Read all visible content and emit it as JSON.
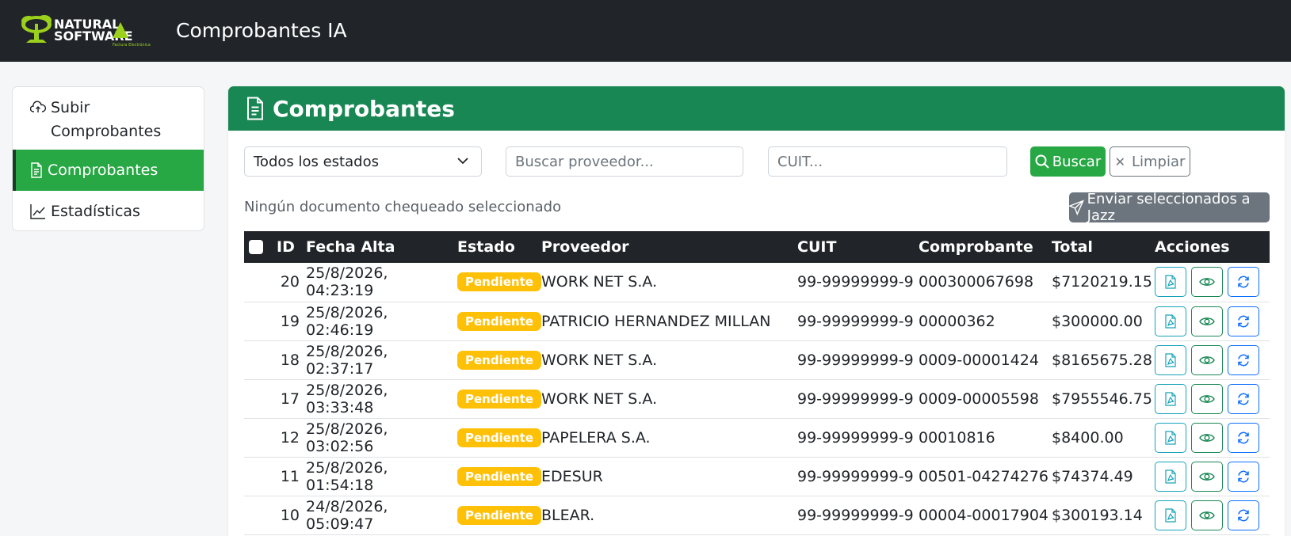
{
  "header": {
    "logo_line1": "NATURAL",
    "logo_line2": "SOFTWARE",
    "logo_sub": "Factura Electrónica",
    "title": "Comprobantes IA"
  },
  "sidebar": {
    "items": [
      {
        "label": "Subir Comprobantes",
        "icon": "cloud-upload-icon"
      },
      {
        "label": "Comprobantes",
        "icon": "file-text-icon",
        "active": true
      },
      {
        "label": "Estadísticas",
        "icon": "line-chart-icon"
      }
    ]
  },
  "card": {
    "title": "Comprobantes"
  },
  "filters": {
    "estado_selected": "Todos los estados",
    "proveedor_placeholder": "Buscar proveedor...",
    "cuit_placeholder": "CUIT...",
    "buscar_label": "Buscar",
    "limpiar_label": "Limpiar"
  },
  "selection": {
    "status_text": "Ningún documento chequeado seleccionado",
    "send_label": "Enviar seleccionados a Jazz"
  },
  "table": {
    "columns": [
      "ID",
      "Fecha Alta",
      "Estado",
      "Proveedor",
      "CUIT",
      "Comprobante",
      "Total",
      "Acciones"
    ],
    "rows": [
      {
        "id": "20",
        "fecha": "25/8/2026, 04:23:19",
        "estado": "Pendiente",
        "proveedor": "WORK NET S.A.",
        "cuit": "99-99999999-9",
        "comprobante": "000300067698",
        "total": "$7120219.15"
      },
      {
        "id": "19",
        "fecha": "25/8/2026, 02:46:19",
        "estado": "Pendiente",
        "proveedor": "PATRICIO HERNANDEZ MILLAN",
        "cuit": "99-99999999-9",
        "comprobante": "00000362",
        "total": "$300000.00"
      },
      {
        "id": "18",
        "fecha": "25/8/2026, 02:37:17",
        "estado": "Pendiente",
        "proveedor": "WORK NET S.A.",
        "cuit": "99-99999999-9",
        "comprobante": "0009-00001424",
        "total": "$8165675.28"
      },
      {
        "id": "17",
        "fecha": "25/8/2026, 03:33:48",
        "estado": "Pendiente",
        "proveedor": "WORK NET S.A.",
        "cuit": "99-99999999-9",
        "comprobante": "0009-00005598",
        "total": "$7955546.75"
      },
      {
        "id": "12",
        "fecha": "25/8/2026, 03:02:56",
        "estado": "Pendiente",
        "proveedor": "PAPELERA S.A.",
        "cuit": "99-99999999-9",
        "comprobante": "00010816",
        "total": "$8400.00"
      },
      {
        "id": "11",
        "fecha": "25/8/2026, 01:54:18",
        "estado": "Pendiente",
        "proveedor": "EDESUR",
        "cuit": "99-99999999-9",
        "comprobante": "00501-04274276",
        "total": "$74374.49"
      },
      {
        "id": "10",
        "fecha": "24/8/2026, 05:09:47",
        "estado": "Pendiente",
        "proveedor": "BLEAR.",
        "cuit": "99-99999999-9",
        "comprobante": "00004-00017904",
        "total": "$300193.14"
      }
    ]
  },
  "colors": {
    "topbar": "#212529",
    "brand_green": "#198754",
    "active_green": "#28a745",
    "badge_yellow": "#ffc107",
    "logo_lime": "#9bd11c"
  }
}
